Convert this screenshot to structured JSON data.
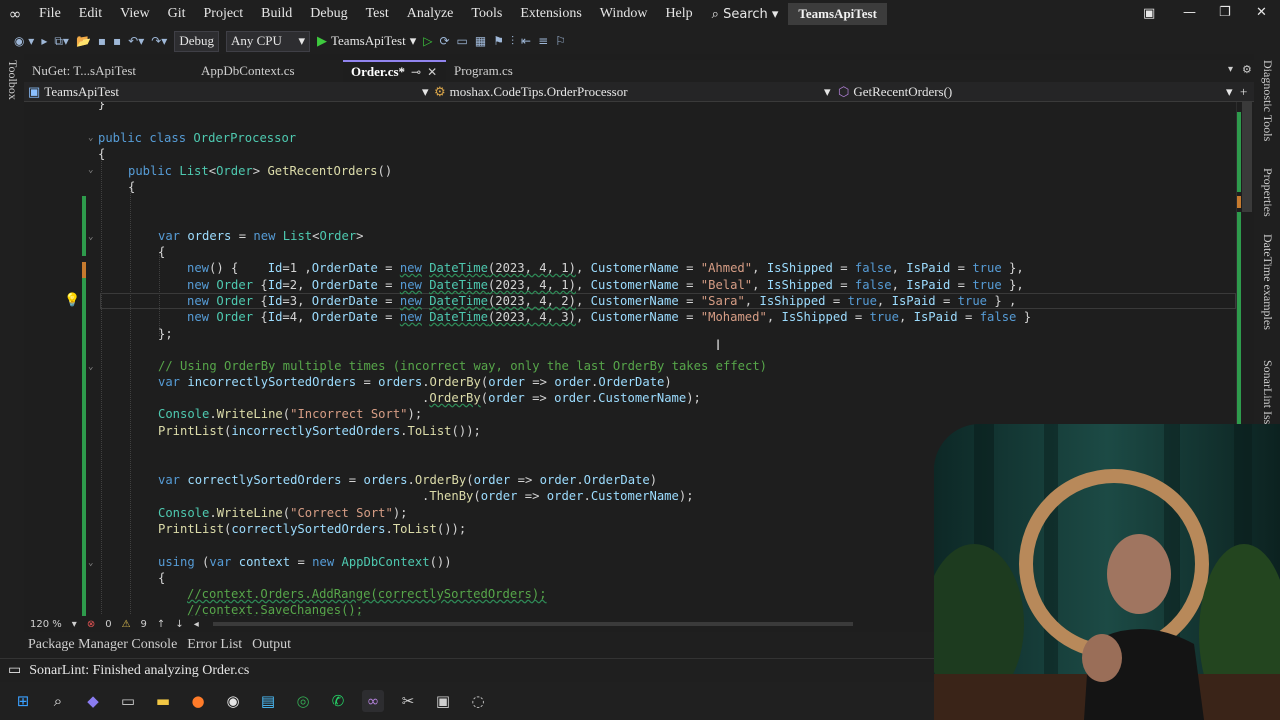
{
  "menu": {
    "items": [
      "File",
      "Edit",
      "View",
      "Git",
      "Project",
      "Build",
      "Debug",
      "Test",
      "Analyze",
      "Tools",
      "Extensions",
      "Window",
      "Help"
    ],
    "search": "Search",
    "project_title": "TeamsApiTest"
  },
  "toolbar": {
    "config": "Debug",
    "platform": "Any CPU",
    "run_target": "TeamsApiTest"
  },
  "tabs": [
    {
      "label": "NuGet: T...sApiTest"
    },
    {
      "label": "AppDbContext.cs"
    },
    {
      "label": "Order.cs*",
      "active": true
    },
    {
      "label": "Program.cs"
    }
  ],
  "navbar": {
    "project": "TeamsApiTest",
    "class": "moshax.CodeTips.OrderProcessor",
    "member": "GetRecentOrders()"
  },
  "side": {
    "left": "Toolbox",
    "right": [
      "Diagnostic Tools",
      "Properties",
      "DateTime examples",
      "SonarLint Issue Visual"
    ]
  },
  "editor": {
    "zoom": "120 %",
    "errors": "0",
    "warnings": "9"
  },
  "bottom_tabs": [
    "Package Manager Console",
    "Error List",
    "Output"
  ],
  "status": {
    "message": "SonarLint: Finished analyzing Order.cs"
  },
  "colors": {
    "accent": "#9184ee",
    "keyword": "#569cd6",
    "type": "#4ec9b0",
    "method": "#dcdcaa",
    "string": "#d69d85",
    "comment": "#57a64a"
  }
}
